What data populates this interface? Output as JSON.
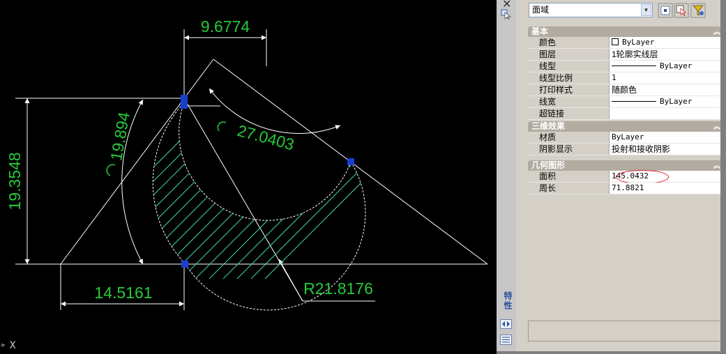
{
  "cad": {
    "dimensions": {
      "top_width": "9.6774",
      "left_height": "19.3548",
      "left_angle": "19.894",
      "arc_angle": "27.0403",
      "bottom_width": "14.5161",
      "radius": "R21.8176"
    },
    "coord_label": "X"
  },
  "palette": {
    "object_type": "面域",
    "title": "特性",
    "sections": {
      "general": {
        "title": "基本",
        "rows": [
          {
            "label": "颜色",
            "value": "ByLayer"
          },
          {
            "label": "图层",
            "value": "1轮廓实线层"
          },
          {
            "label": "线型",
            "value": "ByLayer"
          },
          {
            "label": "线型比例",
            "value": "1"
          },
          {
            "label": "打印样式",
            "value": "随颜色"
          },
          {
            "label": "线宽",
            "value": "ByLayer"
          },
          {
            "label": "超链接",
            "value": ""
          }
        ]
      },
      "3d": {
        "title": "三维效果",
        "rows": [
          {
            "label": "材质",
            "value": "ByLayer"
          },
          {
            "label": "阴影显示",
            "value": "投射和接收阴影"
          }
        ]
      },
      "geometry": {
        "title": "几何图形",
        "rows": [
          {
            "label": "面积",
            "value": "145.0432"
          },
          {
            "label": "周长",
            "value": "71.8821"
          }
        ]
      }
    }
  },
  "colors": {
    "dimension_text": "#27c93a",
    "grip": "#1a3fd0",
    "highlight_circle": "#d8161b",
    "hatch": "#3fd6b6"
  }
}
